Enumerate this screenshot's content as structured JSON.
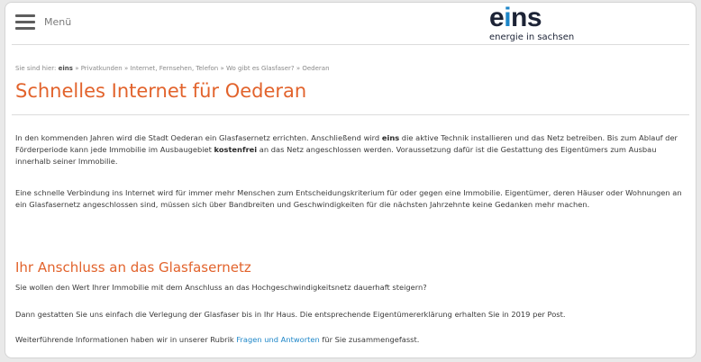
{
  "header": {
    "menu_label": "Menü",
    "logo_word": {
      "e": "e",
      "i": "i",
      "ns": "ns"
    },
    "logo_tagline": "energie in sachsen"
  },
  "breadcrumb": {
    "prefix": "Sie sind hier:",
    "brand": "eins",
    "items": [
      "» Privatkunden",
      "» Internet, Fernsehen, Telefon",
      "» Wo gibt es Glasfaser?",
      "» Oederan"
    ]
  },
  "page": {
    "title": "Schnelles Internet für Oederan",
    "para1": {
      "t1": "In den kommenden Jahren wird die Stadt Oederan ein Glasfasernetz errichten. Anschließend wird ",
      "b1": "eins",
      "t2": " die aktive Technik installieren und das Netz betreiben. Bis zum Ablauf der Förderperiode kann jede Immobilie im Ausbaugebiet ",
      "b2": "kostenfrei",
      "t3": " an das Netz angeschlossen werden. Voraussetzung dafür ist die Gestattung des Eigentümers zum Ausbau innerhalb seiner Immobilie."
    },
    "para2": "Eine schnelle Verbindung ins Internet wird für immer mehr Menschen zum Entscheidungskriterium für oder gegen eine Immobilie. Eigentümer, deren Häuser oder Wohnungen an ein Glasfasernetz angeschlossen sind, müssen sich über Bandbreiten und Geschwindigkeiten für die nächsten Jahrzehnte keine Gedanken mehr machen.",
    "section_title": "Ihr Anschluss an das Glasfasernetz",
    "para3": "Sie wollen den Wert Ihrer Immobilie mit dem Anschluss an das Hochgeschwindigkeitsnetz dauerhaft steigern?",
    "para4": "Dann gestatten Sie uns einfach die Verlegung der Glasfaser bis in Ihr Haus. Die entsprechende Eigentümererklärung erhalten Sie in 2019 per Post.",
    "para5": {
      "before": "Weiterführende Informationen haben wir in unserer Rubrik ",
      "link": "Fragen und Antworten",
      "after": " für Sie zusammengefasst."
    }
  },
  "colors": {
    "accent": "#e2632c",
    "link": "#1d86c8",
    "logo_dark": "#1c2336"
  }
}
